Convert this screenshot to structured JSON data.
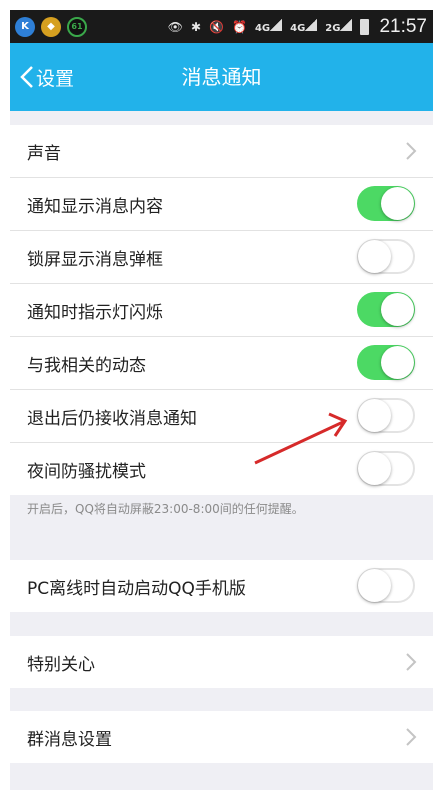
{
  "status_bar": {
    "icons": [
      "kik-icon",
      "app-icon",
      "battery-ring-icon",
      "eye-icon",
      "bluetooth-icon",
      "mute-icon",
      "alarm-icon",
      "4g-signal-icon",
      "4g-signal-icon",
      "2g-signal-icon",
      "battery-icon"
    ],
    "badge_61": "61",
    "net1": "4G",
    "net2": "4G",
    "net3": "2G",
    "time": "21:57"
  },
  "nav": {
    "back_label": "设置",
    "title": "消息通知"
  },
  "group1": {
    "items": [
      {
        "label": "声音",
        "control": "chevron"
      },
      {
        "label": "通知显示消息内容",
        "control": "toggle",
        "on": true
      },
      {
        "label": "锁屏显示消息弹框",
        "control": "toggle",
        "on": false
      },
      {
        "label": "通知时指示灯闪烁",
        "control": "toggle",
        "on": true
      },
      {
        "label": "与我相关的动态",
        "control": "toggle",
        "on": true
      },
      {
        "label": "退出后仍接收消息通知",
        "control": "toggle",
        "on": false
      },
      {
        "label": "夜间防骚扰模式",
        "control": "toggle",
        "on": false
      }
    ],
    "hint": "开启后，QQ将自动屏蔽23:00-8:00间的任何提醒。"
  },
  "group2": {
    "items": [
      {
        "label": "PC离线时自动启动QQ手机版",
        "control": "toggle",
        "on": false
      }
    ]
  },
  "group3": {
    "items": [
      {
        "label": "特别关心",
        "control": "chevron"
      }
    ]
  },
  "group4": {
    "items": [
      {
        "label": "群消息设置",
        "control": "chevron"
      }
    ]
  },
  "colors": {
    "nav": "#22b2ea",
    "toggle_on": "#4cd964",
    "annotation_arrow": "#d62a2a"
  }
}
